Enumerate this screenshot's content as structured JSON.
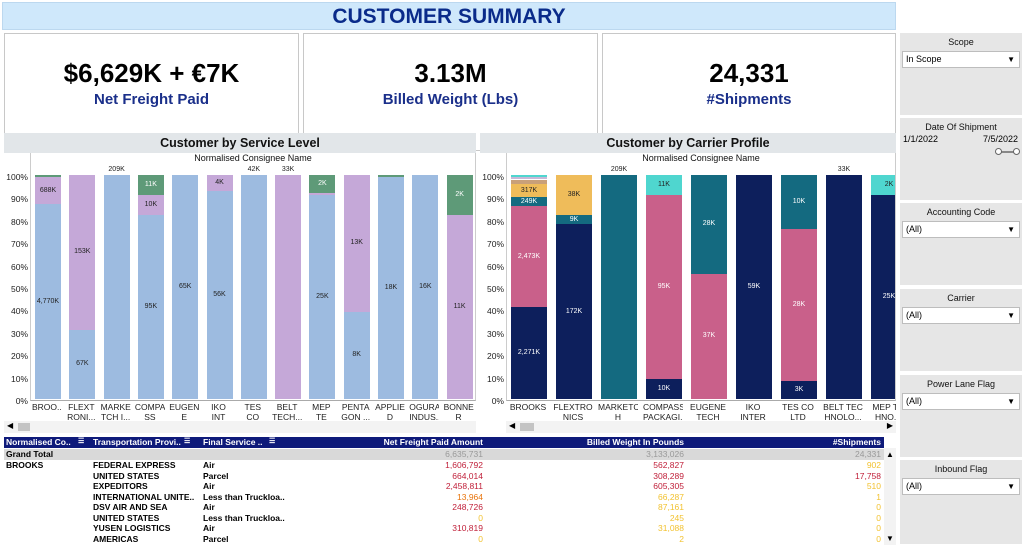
{
  "title": "CUSTOMER SUMMARY",
  "kpis": [
    {
      "value": "$6,629K + €7K",
      "label": "Net Freight Paid"
    },
    {
      "value": "3.13M",
      "label": "Billed Weight (Lbs)"
    },
    {
      "value": "24,331",
      "label": "#Shipments"
    }
  ],
  "left_chart": {
    "title": "Customer by Service Level",
    "subtitle": "Normalised Consignee Name",
    "yticks": [
      "100%",
      "90%",
      "80%",
      "70%",
      "60%",
      "50%",
      "40%",
      "30%",
      "20%",
      "10%",
      "0%"
    ],
    "colors": {
      "air": "#9dbbe0",
      "parcel": "#c5a8d8",
      "ltl": "#5e9a78",
      "other": "#8a8a8a"
    },
    "chart_data": {
      "type": "bar",
      "stacked": true,
      "ylim": [
        0,
        100
      ],
      "categories": [
        "BROO...",
        "FLEXT RONI...",
        "MARKE TCH I...",
        "COMPA SS PA...",
        "EUGEN E TECH",
        "IKO INT ERNA...",
        "TES CO LTD",
        "BELT TECH...",
        "MEP TE CHNO...",
        "PENTA GON ...",
        "APPLIE D MAT...",
        "OGURA INDUS...",
        "BONNE R MET..."
      ],
      "bars": [
        {
          "top": "",
          "segments": [
            {
              "c": "air",
              "p": 87,
              "t": "4,770K"
            },
            {
              "c": "parcel",
              "p": 12,
              "t": "688K"
            },
            {
              "c": "ltl",
              "p": 1,
              "t": ""
            }
          ]
        },
        {
          "top": "",
          "segments": [
            {
              "c": "air",
              "p": 31,
              "t": "67K"
            },
            {
              "c": "parcel",
              "p": 69,
              "t": "153K"
            }
          ]
        },
        {
          "top": "209K",
          "segments": [
            {
              "c": "air",
              "p": 100,
              "t": ""
            }
          ]
        },
        {
          "top": "",
          "segments": [
            {
              "c": "air",
              "p": 82,
              "t": "95K"
            },
            {
              "c": "parcel",
              "p": 9,
              "t": "10K"
            },
            {
              "c": "ltl",
              "p": 9,
              "t": "11K"
            }
          ]
        },
        {
          "top": "",
          "segments": [
            {
              "c": "air",
              "p": 100,
              "t": "65K"
            }
          ]
        },
        {
          "top": "",
          "segments": [
            {
              "c": "air",
              "p": 93,
              "t": "56K"
            },
            {
              "c": "parcel",
              "p": 7,
              "t": "4K"
            }
          ]
        },
        {
          "top": "42K",
          "segments": [
            {
              "c": "air",
              "p": 100,
              "t": ""
            }
          ]
        },
        {
          "top": "33K",
          "segments": [
            {
              "c": "parcel",
              "p": 100,
              "t": ""
            }
          ]
        },
        {
          "top": "",
          "segments": [
            {
              "c": "air",
              "p": 91,
              "t": "25K"
            },
            {
              "c": "parcel",
              "p": 1,
              "t": ""
            },
            {
              "c": "ltl",
              "p": 8,
              "t": "2K"
            }
          ]
        },
        {
          "top": "",
          "segments": [
            {
              "c": "air",
              "p": 39,
              "t": "8K"
            },
            {
              "c": "parcel",
              "p": 61,
              "t": "13K"
            }
          ]
        },
        {
          "top": "",
          "segments": [
            {
              "c": "air",
              "p": 99,
              "t": "18K"
            },
            {
              "c": "ltl",
              "p": 1,
              "t": ""
            }
          ]
        },
        {
          "top": "",
          "segments": [
            {
              "c": "air",
              "p": 100,
              "t": "16K"
            }
          ]
        },
        {
          "top": "",
          "segments": [
            {
              "c": "parcel",
              "p": 82,
              "t": "11K"
            },
            {
              "c": "ltl",
              "p": 18,
              "t": "2K"
            }
          ]
        }
      ]
    }
  },
  "right_chart": {
    "title": "Customer by Carrier Profile",
    "subtitle": "Normalised Consignee Name",
    "yticks": [
      "100%",
      "90%",
      "80%",
      "70%",
      "60%",
      "50%",
      "40%",
      "30%",
      "20%",
      "10%",
      "0%"
    ],
    "colors": {
      "navy": "#0d1f5c",
      "pink": "#c9608a",
      "teal": "#146a80",
      "gold": "#efbc5a",
      "cyan": "#4fd6cf",
      "tan": "#c9a079",
      "lav": "#c8b8d8"
    },
    "chart_data": {
      "type": "bar",
      "stacked": true,
      "ylim": [
        0,
        100
      ],
      "categories": [
        "BROOKS",
        "FLEXTRO NICS MA...",
        "MARKETC H INTER...",
        "COMPASS PACKAGI...",
        "EUGENE TECH",
        "IKO INTER NATIONA...",
        "TES CO LTD",
        "BELT TEC HNOLO...",
        "MEP TE HNO..."
      ],
      "bars": [
        {
          "top": "",
          "segments": [
            {
              "c": "navy",
              "p": 41,
              "t": "2,271K"
            },
            {
              "c": "pink",
              "p": 45,
              "t": "2,473K"
            },
            {
              "c": "teal",
              "p": 4,
              "t": "249K"
            },
            {
              "c": "gold",
              "p": 6,
              "t": "317K"
            },
            {
              "c": "tan",
              "p": 2,
              "t": ""
            },
            {
              "c": "lav",
              "p": 1,
              "t": ""
            },
            {
              "c": "cyan",
              "p": 1,
              "t": ""
            }
          ]
        },
        {
          "top": "",
          "segments": [
            {
              "c": "navy",
              "p": 78,
              "t": "172K"
            },
            {
              "c": "teal",
              "p": 4,
              "t": "9K"
            },
            {
              "c": "gold",
              "p": 18,
              "t": "38K"
            }
          ]
        },
        {
          "top": "209K",
          "segments": [
            {
              "c": "teal",
              "p": 100,
              "t": ""
            }
          ]
        },
        {
          "top": "",
          "segments": [
            {
              "c": "navy",
              "p": 9,
              "t": "10K"
            },
            {
              "c": "pink",
              "p": 82,
              "t": "95K"
            },
            {
              "c": "cyan",
              "p": 9,
              "t": "11K"
            }
          ]
        },
        {
          "top": "",
          "segments": [
            {
              "c": "pink",
              "p": 56,
              "t": "37K"
            },
            {
              "c": "teal",
              "p": 44,
              "t": "28K"
            }
          ]
        },
        {
          "top": "",
          "segments": [
            {
              "c": "navy",
              "p": 100,
              "t": "59K"
            }
          ]
        },
        {
          "top": "",
          "segments": [
            {
              "c": "navy",
              "p": 8,
              "t": "3K"
            },
            {
              "c": "pink",
              "p": 68,
              "t": "28K"
            },
            {
              "c": "teal",
              "p": 24,
              "t": "10K"
            }
          ]
        },
        {
          "top": "33K",
          "segments": [
            {
              "c": "navy",
              "p": 100,
              "t": ""
            }
          ]
        },
        {
          "top": "",
          "segments": [
            {
              "c": "navy",
              "p": 91,
              "t": "25K"
            },
            {
              "c": "cyan",
              "p": 9,
              "t": "2K"
            }
          ]
        }
      ]
    }
  },
  "table": {
    "headers": [
      "Normalised Co..",
      "Transportation Provi..",
      "Final Service ..",
      "Net Freight Paid Amount",
      "Billed Weight In Pounds",
      "#Shipments"
    ],
    "grand_total": {
      "label": "Grand Total",
      "nfp": "6,635,731",
      "bw": "3,133,026",
      "ship": "24,331"
    },
    "rows": [
      {
        "c": "BROOKS",
        "p": "FEDERAL EXPRESS",
        "s": "Air",
        "nfp": "1,606,792",
        "nc": "red",
        "bw": "562,827",
        "bc": "red",
        "sh": "902",
        "sc": "yel"
      },
      {
        "c": "",
        "p": "UNITED STATES",
        "s": "Parcel",
        "nfp": "664,014",
        "nc": "red",
        "bw": "308,289",
        "bc": "red",
        "sh": "17,758",
        "sc": "red"
      },
      {
        "c": "",
        "p": "EXPEDITORS",
        "s": "Air",
        "nfp": "2,458,811",
        "nc": "red",
        "bw": "605,305",
        "bc": "red",
        "sh": "510",
        "sc": "yel"
      },
      {
        "c": "",
        "p": "INTERNATIONAL UNITE..",
        "s": "Less than Truckloa..",
        "nfp": "13,964",
        "nc": "ora",
        "bw": "66,287",
        "bc": "yel",
        "sh": "1",
        "sc": "yel"
      },
      {
        "c": "",
        "p": "DSV AIR AND SEA",
        "s": "Air",
        "nfp": "248,726",
        "nc": "red",
        "bw": "87,161",
        "bc": "yel",
        "sh": "0",
        "sc": "yel"
      },
      {
        "c": "",
        "p": "UNITED STATES",
        "s": "Less than Truckloa..",
        "nfp": "0",
        "nc": "yel",
        "bw": "245",
        "bc": "yel",
        "sh": "0",
        "sc": "yel"
      },
      {
        "c": "",
        "p": "YUSEN LOGISTICS",
        "s": "Air",
        "nfp": "310,819",
        "nc": "red",
        "bw": "31,088",
        "bc": "yel",
        "sh": "0",
        "sc": "yel"
      },
      {
        "c": "",
        "p": "AMERICAS",
        "s": "Parcel",
        "nfp": "0",
        "nc": "yel",
        "bw": "2",
        "bc": "yel",
        "sh": "0",
        "sc": "yel"
      }
    ]
  },
  "filters": [
    {
      "title": "Scope",
      "value": "In Scope"
    },
    {
      "title": "Date Of Shipment",
      "start": "1/1/2022",
      "end": "7/5/2022"
    },
    {
      "title": "Accounting Code",
      "value": "(All)"
    },
    {
      "title": "Carrier",
      "value": "(All)"
    },
    {
      "title": "Power Lane Flag",
      "value": "(All)"
    },
    {
      "title": "Inbound Flag",
      "value": "(All)"
    }
  ]
}
